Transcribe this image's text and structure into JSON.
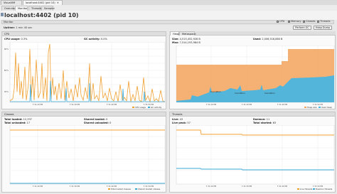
{
  "tabs": [
    {
      "label": "VisualVM"
    },
    {
      "label": "localhost:4402 (pid 10)"
    }
  ],
  "subtabs": [
    "Overview",
    "Monitor",
    "Threads",
    "Sampler"
  ],
  "header": {
    "title": "localhost:4402 (pid 10)"
  },
  "monitor": {
    "section_label": "Monitor",
    "uptime_label": "Uptime:",
    "uptime_value": "1 min 40 sec",
    "checkboxes": [
      {
        "label": "CPU",
        "checked": true
      },
      {
        "label": "Memory",
        "checked": true
      },
      {
        "label": "Classes",
        "checked": true
      },
      {
        "label": "Threads",
        "checked": true
      }
    ],
    "perform_gc_label": "Perform GC",
    "heap_dump_label": "Heap Dump"
  },
  "cpu": {
    "title": "CPU",
    "cpu_usage_label": "CPU usage:",
    "cpu_usage_value": "0.3%",
    "gc_activity_label": "GC activity:",
    "gc_activity_value": "0.0%",
    "legend": [
      "CPU usage",
      "GC activity"
    ],
    "colors": {
      "cpu": "#f0a030",
      "gc": "#3aa9d8"
    }
  },
  "heap": {
    "tabs": [
      "Heap",
      "Metaspace"
    ],
    "size_label": "Size:",
    "size_value": "4,515,452,928 B",
    "used_label": "Used:",
    "used_value": "2,006,516,880 B",
    "max_label": "Max:",
    "max_value": "7,514,193,984 B",
    "annotations": [
      "Invocation",
      "Invocation",
      "Invocation"
    ],
    "legend": [
      "Heap size",
      "Used heap"
    ],
    "colors": {
      "size": "#f3a35c",
      "used": "#41b6e6"
    }
  },
  "classes": {
    "title": "Classes",
    "total_loaded_label": "Total loaded:",
    "total_loaded_value": "12,337",
    "total_unloaded_label": "Total unloaded:",
    "total_unloaded_value": "17",
    "shared_loaded_label": "Shared loaded:",
    "shared_loaded_value": "0",
    "shared_unloaded_label": "Shared unloaded:",
    "shared_unloaded_value": "0",
    "legend": [
      "Total loaded classes",
      "Shared loaded classes"
    ],
    "colors": {
      "total": "#f0a030",
      "shared": "#3aa9d8"
    }
  },
  "threads": {
    "title": "Threads",
    "live_label": "Live:",
    "live_value": "43",
    "live_peak_label": "Live peak:",
    "live_peak_value": "57",
    "daemon_label": "Daemon:",
    "daemon_value": "11",
    "total_started_label": "Total started:",
    "total_started_value": "63",
    "legend": [
      "Live threads",
      "Daemon threads"
    ],
    "colors": {
      "live": "#f0a030",
      "daemon": "#3aa9d8"
    }
  },
  "time_ticks": [
    "7:31:20 PM",
    "7:31:30 PM",
    "7:31:40 PM",
    "7:31:50 PM"
  ]
}
